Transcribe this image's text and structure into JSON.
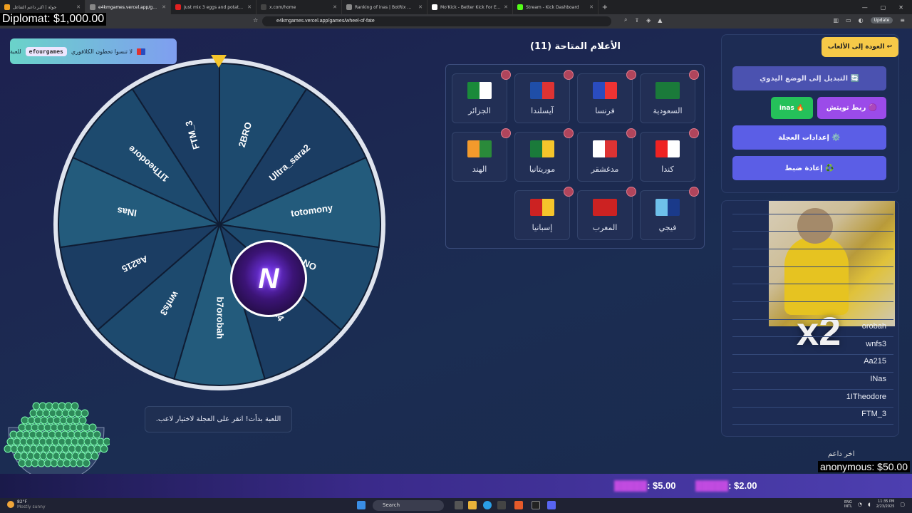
{
  "browser": {
    "tabs": [
      {
        "label": "جولة | اكبر داعم التفاعل",
        "color": "#f0a020"
      },
      {
        "label": "e4kmgames.vercel.app/games/w",
        "color": "#888888",
        "active": true
      },
      {
        "label": "Just mix 3 eggs and potatoes! This d",
        "color": "#e02020"
      },
      {
        "label": "x.com/home",
        "color": "#444444"
      },
      {
        "label": "Ranking of inas | BotRix — Cloud Str",
        "color": "#8a8a8a"
      },
      {
        "label": "Mo'Kick - Better Kick For Everyone -",
        "color": "#ffffff"
      },
      {
        "label": "Stream - Kick Dashboard",
        "color": "#53fc18"
      }
    ],
    "url": "e4kmgames.vercel.app/games/wheel-of-fate",
    "update_label": "Update"
  },
  "overlay_money": "Diplomat: $1,000.00",
  "notice": {
    "text": "لا تنسوا تحطون الكلاقوري",
    "tag": "efourgames",
    "suffix": "للعبة"
  },
  "wheel": {
    "names": [
      "2BRO",
      "Ultra_sara2",
      "totomony",
      "5LNO",
      "omtoto14",
      "b7orobah",
      "wnfs3",
      "Aa215",
      "INas",
      "1ITheodore",
      "FTM_3"
    ],
    "colors": [
      "#1d4a6e",
      "#1b3d63",
      "#235b7c",
      "#1d4a6e",
      "#1b3d63",
      "#235b7c",
      "#1d4a6e",
      "#1b3d63",
      "#235b7c",
      "#1d4a6e",
      "#1b3d63"
    ],
    "center_letter": "N"
  },
  "status_message": "اللعبة بدأت! انقر على العجلة لاختيار لاعب.",
  "flags": {
    "title": "الأعلام المتاحة (11)",
    "items": [
      {
        "name": "السعودية",
        "icon": "saudi-flag-icon",
        "c1": "#1a7a3a",
        "c2": "#1a7a3a"
      },
      {
        "name": "فرنسا",
        "icon": "france-flag-icon",
        "c1": "#2a4cbf",
        "c2": "#e33"
      },
      {
        "name": "آيسلندا",
        "icon": "iceland-flag-icon",
        "c1": "#1f4ea8",
        "c2": "#d33"
      },
      {
        "name": "الجزائر",
        "icon": "algeria-flag-icon",
        "c1": "#1a8a3a",
        "c2": "#ffffff"
      },
      {
        "name": "كندا",
        "icon": "canada-flag-icon",
        "c1": "#e22",
        "c2": "#ffffff"
      },
      {
        "name": "مدغشقر",
        "icon": "madagascar-flag-icon",
        "c1": "#ffffff",
        "c2": "#d33"
      },
      {
        "name": "موريتانيا",
        "icon": "mauritania-flag-icon",
        "c1": "#1a7a3a",
        "c2": "#f5c52b"
      },
      {
        "name": "الهند",
        "icon": "india-flag-icon",
        "c1": "#f39a2c",
        "c2": "#2a8a3a"
      },
      {
        "name": "فيجي",
        "icon": "fiji-flag-icon",
        "c1": "#6ec0ea",
        "c2": "#1a3a8a"
      },
      {
        "name": "المغرب",
        "icon": "morocco-flag-icon",
        "c1": "#c22",
        "c2": "#c22"
      },
      {
        "name": "إسبانيا",
        "icon": "spain-flag-icon",
        "c1": "#c22",
        "c2": "#f5c52b"
      }
    ]
  },
  "controls": {
    "back": "↩ العودة إلى الألعاب",
    "manual_mode": "🔄 التبديل إلى الوضع اليدوي",
    "twitch_link": "🟣 ربط تويتش",
    "twitch_user": "🔥 inas",
    "wheel_settings": "⚙️ إعدادات العجلة",
    "reset": "♻️ إعادة ضبط"
  },
  "player_list": [
    "orobah",
    "wnfs3",
    "Aa215",
    "INas",
    "1ITheodore",
    "FTM_3"
  ],
  "gif_overlay_text": "x2",
  "donations": {
    "header": "اخر داعم",
    "last": "anonymous: $50.00",
    "ticker": [
      {
        "name": "█████",
        "amount": ": $5.00"
      },
      {
        "name": "█████",
        "amount": ": $2.00"
      }
    ]
  },
  "taskbar": {
    "weather_temp": "82°F",
    "weather_desc": "Mostly sunny",
    "search": "Search",
    "lang1": "ENG",
    "lang2": "INTL",
    "time": "11:35 PM",
    "date": "2/23/2025"
  }
}
